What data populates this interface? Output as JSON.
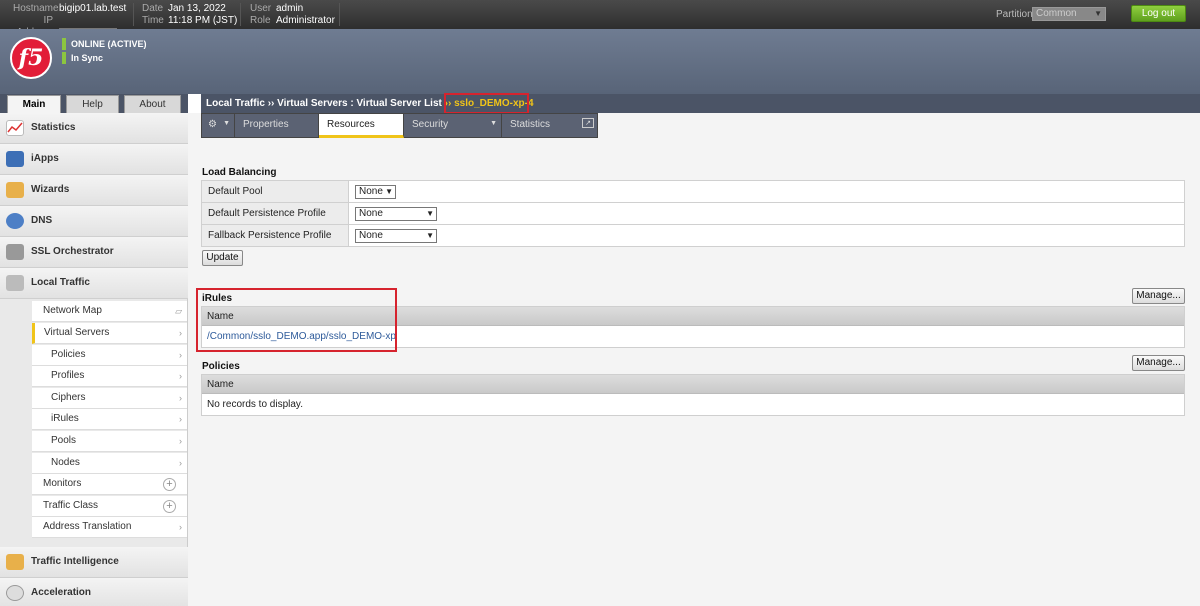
{
  "topbar": {
    "hostname_label": "Hostname",
    "hostname": "bigip01.lab.test",
    "ip_label": "IP Address",
    "date_label": "Date",
    "date": "Jan 13, 2022",
    "time_label": "Time",
    "time": "11:18 PM (JST)",
    "user_label": "User",
    "user": "admin",
    "role_label": "Role",
    "role": "Administrator",
    "partition_label": "Partition:",
    "partition_value": "Common",
    "logout_label": "Log out"
  },
  "header": {
    "logo_text": "f5",
    "status_online": "ONLINE (ACTIVE)",
    "status_sync": "In Sync"
  },
  "nav": {
    "tabs": [
      "Main",
      "Help",
      "About"
    ],
    "sections": {
      "statistics": "Statistics",
      "iapps": "iApps",
      "wizards": "Wizards",
      "dns": "DNS",
      "ssl": "SSL Orchestrator",
      "local_traffic": "Local Traffic",
      "traffic_intel": "Traffic Intelligence",
      "acceleration": "Acceleration"
    },
    "local_traffic_items": {
      "network_map": "Network Map",
      "virtual_servers": "Virtual Servers",
      "policies": "Policies",
      "profiles": "Profiles",
      "ciphers": "Ciphers",
      "irules": "iRules",
      "pools": "Pools",
      "nodes": "Nodes",
      "monitors": "Monitors",
      "traffic_class": "Traffic Class",
      "address_translation": "Address Translation"
    }
  },
  "breadcrumb": {
    "part1": "Local Traffic",
    "sep": "››",
    "part2": "Virtual Servers : Virtual Server List",
    "current": "sslo_DEMO-xp-4"
  },
  "subtabs": {
    "properties": "Properties",
    "resources": "Resources",
    "security": "Security",
    "statistics": "Statistics"
  },
  "load_balancing": {
    "title": "Load Balancing",
    "rows": [
      {
        "label": "Default Pool",
        "value": "None"
      },
      {
        "label": "Default Persistence Profile",
        "value": "None"
      },
      {
        "label": "Fallback Persistence Profile",
        "value": "None"
      }
    ],
    "update_label": "Update"
  },
  "irules": {
    "title": "iRules",
    "manage_label": "Manage...",
    "col_name": "Name",
    "items": [
      "/Common/sslo_DEMO.app/sslo_DEMO-xp"
    ]
  },
  "policies": {
    "title": "Policies",
    "manage_label": "Manage...",
    "col_name": "Name",
    "empty": "No records to display."
  },
  "colors": {
    "accent_yellow": "#f0c419",
    "highlight_red": "#d6232e",
    "logout_green": "#6fb32a",
    "brand_red": "#e21d38"
  }
}
